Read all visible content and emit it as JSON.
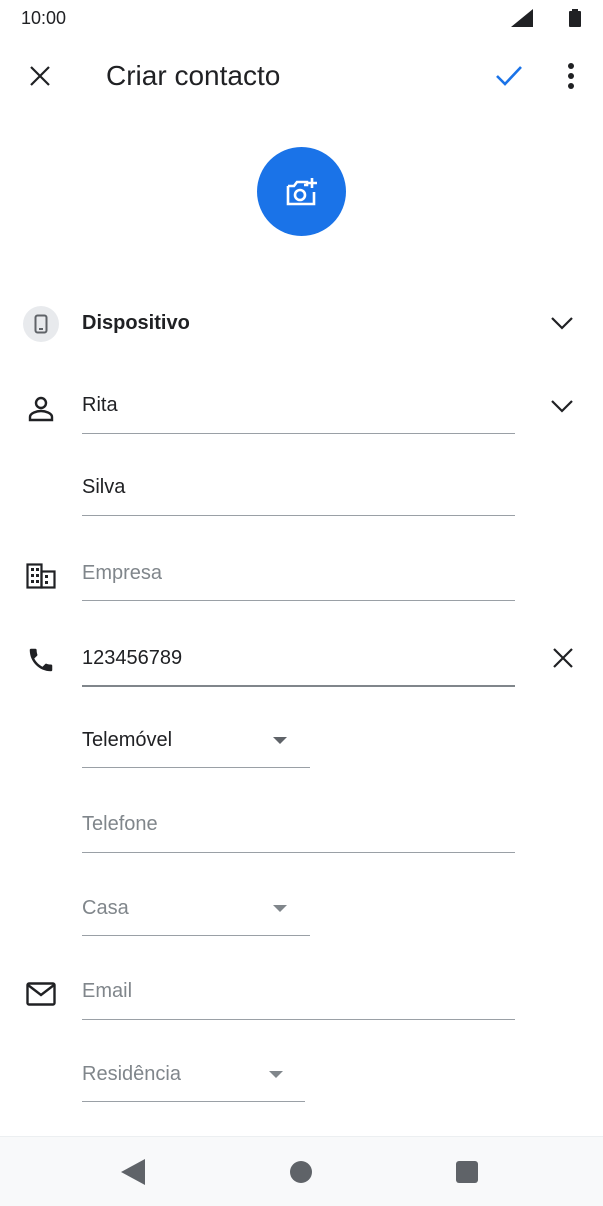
{
  "status_bar": {
    "time": "10:00",
    "signal_icon": "signal-icon",
    "battery_icon": "battery-icon"
  },
  "app_bar": {
    "title": "Criar contacto",
    "close_icon": "close-icon",
    "save_icon": "check-icon",
    "more_icon": "more-vert-icon",
    "accent_color": "#1a73e8"
  },
  "photo": {
    "icon": "add-photo-icon",
    "color": "#1a73e8"
  },
  "account": {
    "label": "Dispositivo",
    "icon": "phone-device-icon"
  },
  "name": {
    "first_name": "Rita",
    "last_name": "Silva",
    "icon": "person-icon"
  },
  "company": {
    "placeholder": "Empresa",
    "icon": "business-icon"
  },
  "phone": {
    "value": "123456789",
    "type": "Telemóvel",
    "icon": "phone-icon",
    "second_placeholder": "Telefone",
    "second_type": "Casa"
  },
  "email": {
    "placeholder": "Email",
    "type": "Residência",
    "icon": "email-icon"
  },
  "nav_bar": {
    "back_icon": "back-icon",
    "home_icon": "home-icon",
    "recents_icon": "recents-icon"
  }
}
